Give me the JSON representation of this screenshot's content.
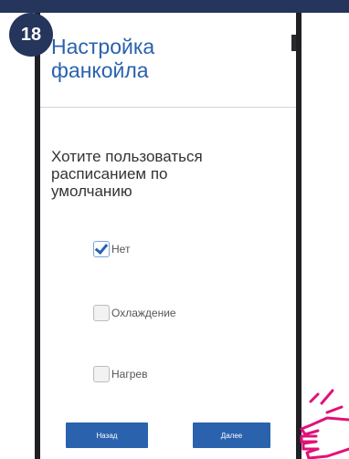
{
  "step": {
    "number": "18"
  },
  "header": {
    "title": "Настройка\nфанкойла"
  },
  "question": "Хотите пользоваться\nрасписанием по\nумолчанию",
  "options": [
    {
      "label": "Нет",
      "checked": true
    },
    {
      "label": "Охлаждение",
      "checked": false
    },
    {
      "label": "Нагрев",
      "checked": false
    }
  ],
  "buttons": {
    "back": "Назад",
    "next": "Далее"
  },
  "colors": {
    "accent": "#2a62ad",
    "badge": "#25355b",
    "hand": "#e0117a",
    "phone_frame": "#1f1f24"
  },
  "icons": {
    "pointer": "pointing-hand-icon",
    "check": "checkmark-icon"
  }
}
